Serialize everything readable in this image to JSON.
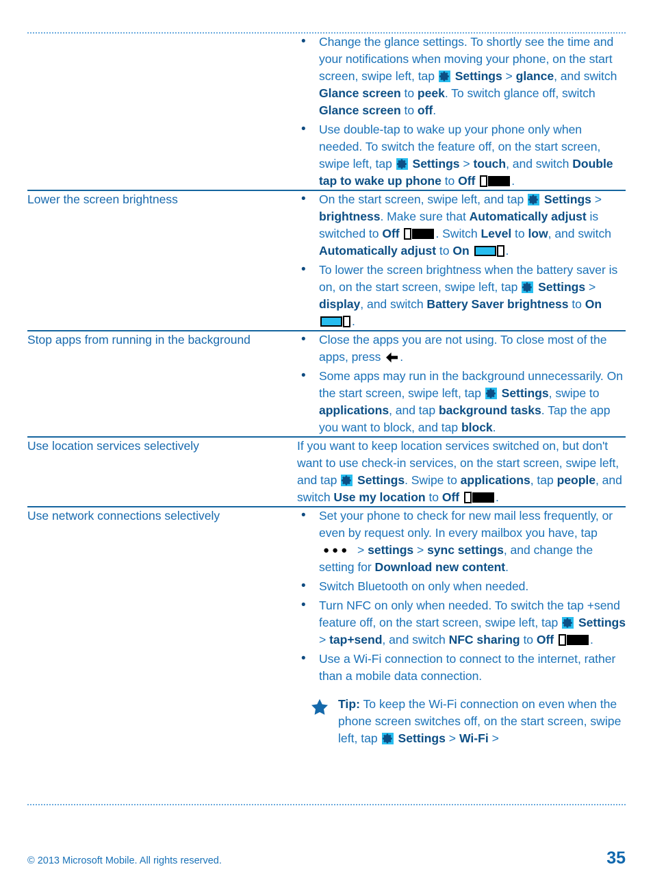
{
  "document": {
    "page_number": "35",
    "copyright": "© 2013 Microsoft Mobile. All rights reserved."
  },
  "icons": {
    "settings": "settings-gear-icon",
    "toggle_off": "toggle-switch-off-icon",
    "toggle_on": "toggle-switch-on-icon",
    "back": "back-arrow-icon",
    "more": "more-ellipsis-icon",
    "tip": "tip-star-icon"
  },
  "colors": {
    "body_text": "#1a72b8",
    "bold_text": "#0d4f85",
    "term_text": "#1769ad",
    "rule_solid": "#14649e",
    "rule_dotted": "#6aaade",
    "icon_accent": "#27bdef",
    "page_number": "#1067ad"
  },
  "rows": [
    {
      "term": "",
      "bullets": [
        {
          "segments": [
            {
              "t": "text",
              "v": "Change the glance settings. To shortly see the time and your notifications when moving your phone, on the start screen, swipe left, tap "
            },
            {
              "t": "icon",
              "v": "settings"
            },
            {
              "t": "bold",
              "v": "Settings"
            },
            {
              "t": "text",
              "v": " > "
            },
            {
              "t": "bold",
              "v": "glance"
            },
            {
              "t": "text",
              "v": ", and switch "
            },
            {
              "t": "bold",
              "v": "Glance screen"
            },
            {
              "t": "text",
              "v": " to "
            },
            {
              "t": "bold",
              "v": "peek"
            },
            {
              "t": "text",
              "v": ". To switch glance off, switch "
            },
            {
              "t": "bold",
              "v": "Glance screen"
            },
            {
              "t": "text",
              "v": " to "
            },
            {
              "t": "bold",
              "v": "off"
            },
            {
              "t": "text",
              "v": "."
            }
          ]
        },
        {
          "segments": [
            {
              "t": "text",
              "v": "Use double-tap to wake up your phone only when needed. To switch the feature off, on the start screen, swipe left, tap "
            },
            {
              "t": "icon",
              "v": "settings"
            },
            {
              "t": "bold",
              "v": "Settings"
            },
            {
              "t": "text",
              "v": " > "
            },
            {
              "t": "bold",
              "v": "touch"
            },
            {
              "t": "text",
              "v": ", and switch "
            },
            {
              "t": "bold",
              "v": "Double tap to wake up phone"
            },
            {
              "t": "text",
              "v": " to "
            },
            {
              "t": "bold",
              "v": "Off"
            },
            {
              "t": "text",
              "v": " "
            },
            {
              "t": "toggle_off",
              "v": ""
            },
            {
              "t": "text",
              "v": "."
            }
          ]
        }
      ]
    },
    {
      "term": "Lower the screen brightness",
      "bullets": [
        {
          "segments": [
            {
              "t": "text",
              "v": "On the start screen, swipe left, and tap "
            },
            {
              "t": "icon",
              "v": "settings"
            },
            {
              "t": "bold",
              "v": "Settings"
            },
            {
              "t": "text",
              "v": " > "
            },
            {
              "t": "bold",
              "v": "brightness"
            },
            {
              "t": "text",
              "v": ". Make sure that "
            },
            {
              "t": "bold",
              "v": "Automatically adjust"
            },
            {
              "t": "text",
              "v": " is switched to "
            },
            {
              "t": "bold",
              "v": "Off"
            },
            {
              "t": "text",
              "v": " "
            },
            {
              "t": "toggle_off",
              "v": ""
            },
            {
              "t": "text",
              "v": ". Switch "
            },
            {
              "t": "bold",
              "v": "Level"
            },
            {
              "t": "text",
              "v": " to "
            },
            {
              "t": "bold",
              "v": "low"
            },
            {
              "t": "text",
              "v": ", and switch "
            },
            {
              "t": "bold",
              "v": "Automatically adjust"
            },
            {
              "t": "text",
              "v": " to "
            },
            {
              "t": "bold",
              "v": "On"
            },
            {
              "t": "text",
              "v": " "
            },
            {
              "t": "toggle_on",
              "v": ""
            },
            {
              "t": "text",
              "v": "."
            }
          ]
        },
        {
          "segments": [
            {
              "t": "text",
              "v": "To lower the screen brightness when the battery saver is on, on the start screen, swipe left, tap "
            },
            {
              "t": "icon",
              "v": "settings"
            },
            {
              "t": "text",
              "v": " "
            },
            {
              "t": "bold",
              "v": "Settings"
            },
            {
              "t": "text",
              "v": " > "
            },
            {
              "t": "bold",
              "v": "display"
            },
            {
              "t": "text",
              "v": ", and switch "
            },
            {
              "t": "bold",
              "v": "Battery Saver brightness"
            },
            {
              "t": "text",
              "v": " to "
            },
            {
              "t": "bold",
              "v": "On"
            },
            {
              "t": "text",
              "v": " "
            },
            {
              "t": "toggle_on",
              "v": ""
            },
            {
              "t": "text",
              "v": "."
            }
          ]
        }
      ]
    },
    {
      "term": "Stop apps from running in the background",
      "bullets": [
        {
          "segments": [
            {
              "t": "text",
              "v": "Close the apps you are not using. To close most of the apps, press "
            },
            {
              "t": "back",
              "v": ""
            },
            {
              "t": "text",
              "v": "."
            }
          ]
        },
        {
          "segments": [
            {
              "t": "text",
              "v": "Some apps may run in the background unnecessarily. On the start screen, swipe left, tap "
            },
            {
              "t": "icon",
              "v": "settings"
            },
            {
              "t": "bold",
              "v": "Settings"
            },
            {
              "t": "text",
              "v": ", swipe to "
            },
            {
              "t": "bold",
              "v": "applications"
            },
            {
              "t": "text",
              "v": ", and tap "
            },
            {
              "t": "bold",
              "v": "background tasks"
            },
            {
              "t": "text",
              "v": ". Tap the app you want to block, and tap "
            },
            {
              "t": "bold",
              "v": "block"
            },
            {
              "t": "text",
              "v": "."
            }
          ]
        }
      ]
    },
    {
      "term": "Use location services selectively",
      "paragraph": {
        "segments": [
          {
            "t": "text",
            "v": "If you want to keep location services switched on, but don't want to use check-in services, on the start screen, swipe left, and tap "
          },
          {
            "t": "icon",
            "v": "settings"
          },
          {
            "t": "bold",
            "v": "Settings"
          },
          {
            "t": "text",
            "v": ". Swipe to "
          },
          {
            "t": "bold",
            "v": "applications"
          },
          {
            "t": "text",
            "v": ", tap "
          },
          {
            "t": "bold",
            "v": "people"
          },
          {
            "t": "text",
            "v": ", and switch "
          },
          {
            "t": "bold",
            "v": "Use my location"
          },
          {
            "t": "text",
            "v": " to "
          },
          {
            "t": "bold",
            "v": "Off"
          },
          {
            "t": "text",
            "v": " "
          },
          {
            "t": "toggle_off",
            "v": ""
          },
          {
            "t": "text",
            "v": "."
          }
        ]
      }
    },
    {
      "term": "Use network connections selectively",
      "bullets": [
        {
          "segments": [
            {
              "t": "text",
              "v": "Set your phone to check for new mail less frequently, or even by request only. In every mailbox you have, tap "
            },
            {
              "t": "more",
              "v": ""
            },
            {
              "t": "text",
              "v": " > "
            },
            {
              "t": "bold",
              "v": "settings"
            },
            {
              "t": "text",
              "v": " > "
            },
            {
              "t": "bold",
              "v": "sync settings"
            },
            {
              "t": "text",
              "v": ", and change the setting for "
            },
            {
              "t": "bold",
              "v": "Download new content"
            },
            {
              "t": "text",
              "v": "."
            }
          ]
        },
        {
          "segments": [
            {
              "t": "text",
              "v": "Switch Bluetooth on only when needed."
            }
          ]
        },
        {
          "segments": [
            {
              "t": "text",
              "v": "Turn NFC on only when needed. To switch the tap +send feature off, on the start screen, swipe left, tap "
            },
            {
              "t": "icon",
              "v": "settings"
            },
            {
              "t": "bold",
              "v": "Settings"
            },
            {
              "t": "text",
              "v": " > "
            },
            {
              "t": "bold",
              "v": "tap+send"
            },
            {
              "t": "text",
              "v": ", and switch "
            },
            {
              "t": "bold",
              "v": "NFC sharing"
            },
            {
              "t": "text",
              "v": " to "
            },
            {
              "t": "bold",
              "v": "Off"
            },
            {
              "t": "text",
              "v": " "
            },
            {
              "t": "toggle_off",
              "v": ""
            },
            {
              "t": "text",
              "v": "."
            }
          ]
        },
        {
          "segments": [
            {
              "t": "text",
              "v": "Use a Wi-Fi connection to connect to the internet, rather than a mobile data connection."
            }
          ]
        }
      ],
      "tip": {
        "segments": [
          {
            "t": "bold",
            "v": "Tip:"
          },
          {
            "t": "text",
            "v": " To keep the Wi-Fi connection on even when the phone screen switches off, on the start screen, swipe left, tap "
          },
          {
            "t": "icon",
            "v": "settings"
          },
          {
            "t": "bold",
            "v": "Settings"
          },
          {
            "t": "text",
            "v": " > "
          },
          {
            "t": "bold",
            "v": "Wi-Fi"
          },
          {
            "t": "text",
            "v": " > "
          }
        ]
      }
    }
  ]
}
